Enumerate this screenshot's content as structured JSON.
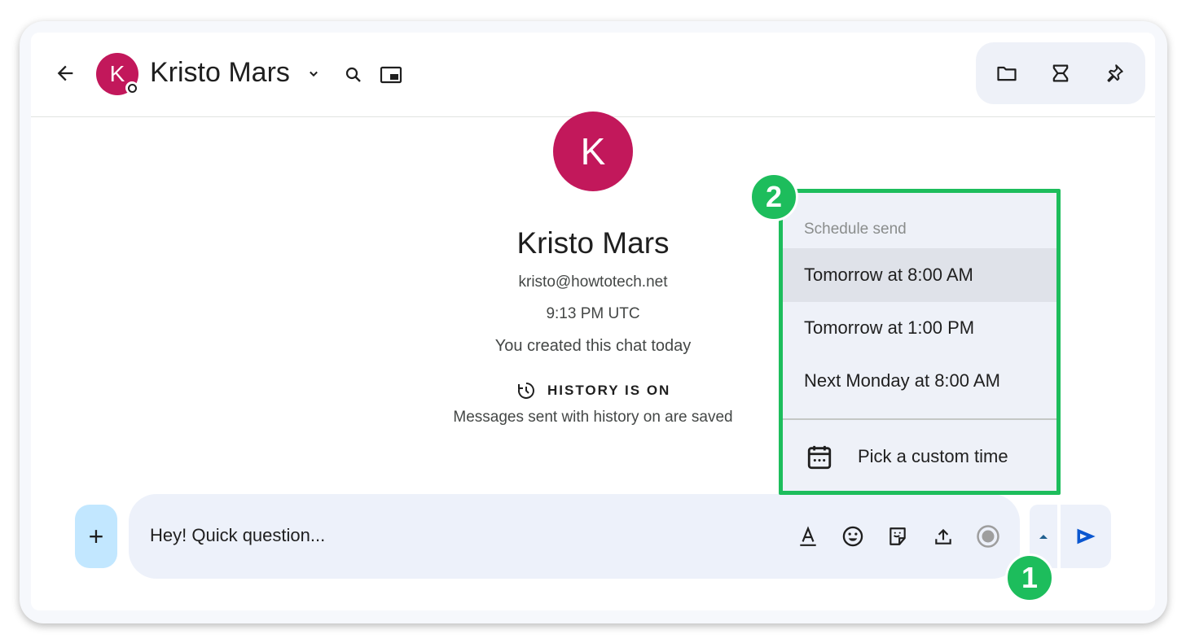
{
  "header": {
    "avatar_initial": "K",
    "contact_name": "Kristo Mars"
  },
  "intro": {
    "avatar_initial": "K",
    "name": "Kristo Mars",
    "email": "kristo@howtotech.net",
    "local_time": "9:13 PM UTC",
    "created_note": "You created this chat today",
    "history_label": "HISTORY IS ON",
    "history_note": "Messages sent with history on are saved"
  },
  "composer": {
    "add_label": "+",
    "message_value": "Hey! Quick question..."
  },
  "schedule_menu": {
    "title": "Schedule send",
    "options": [
      "Tomorrow at 8:00 AM",
      "Tomorrow at 1:00 PM",
      "Next Monday at 8:00 AM"
    ],
    "custom_label": "Pick a custom time"
  },
  "badges": {
    "step1": "1",
    "step2": "2"
  },
  "colors": {
    "avatar": "#c2185b",
    "highlight": "#1dbd5c",
    "send": "#0b57d0",
    "composer_bg": "#edf1fa"
  },
  "icons": [
    "back-arrow-icon",
    "chevron-down-icon",
    "search-icon",
    "picture-in-picture-icon",
    "folder-icon",
    "tasks-icon",
    "pin-icon",
    "history-icon",
    "format-text-icon",
    "emoji-icon",
    "sticker-icon",
    "upload-icon",
    "record-icon",
    "caret-up-icon",
    "send-icon",
    "calendar-icon"
  ]
}
